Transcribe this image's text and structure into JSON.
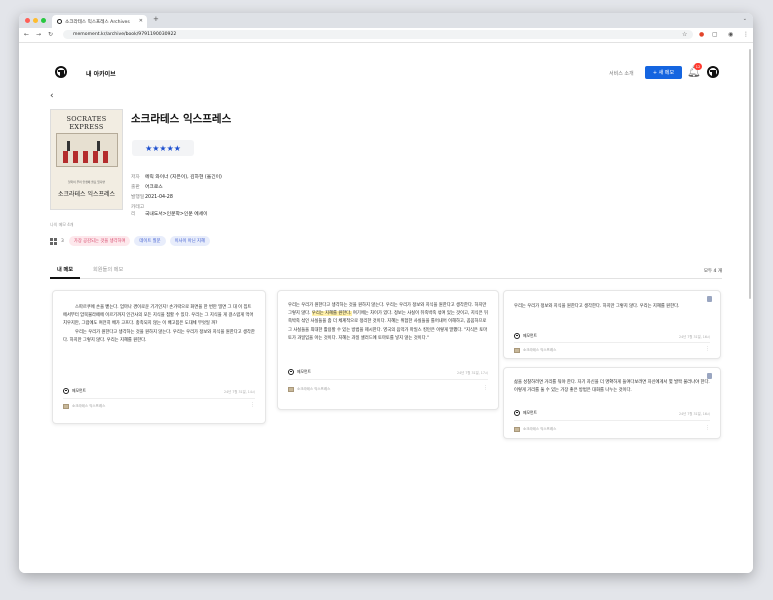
{
  "browser": {
    "tab_title": "소크라테스 익스프레스 Archives",
    "url": "memoment.kr/archive/book/9791190030922"
  },
  "header": {
    "title": "내 아카이브",
    "service_link": "서비스 소개",
    "new_memo_button": "+ 새 메모",
    "notification_count": "12"
  },
  "book": {
    "title": "소크라테스 익스프레스",
    "rating": "★★★★★",
    "cover_title_en": "SOCRATES EXPRESS",
    "cover_subtitle": "철학이 우리 인생에 쓸모 있다면",
    "cover_title_ko": "소크라테스 익스프레스",
    "author_label": "저자",
    "author": "에릭 와이너 (지은이), 김하현 (옮긴이)",
    "publisher_label": "출판",
    "publisher": "어크로스",
    "date_label": "발행일",
    "date": "2021-04-28",
    "category_label": "카테고리",
    "category": "국내도서>인문학>인문 에세이"
  },
  "my_memo_date": "나의 메모 4개",
  "tags": {
    "count": "3",
    "items": [
      {
        "label": "가장 공감되는 것을 생각하며",
        "bg": "#fde8ec",
        "fg": "#d6456a"
      },
      {
        "label": "데이트 질문",
        "bg": "#e8edfb",
        "fg": "#3d5bd0"
      },
      {
        "label": "이사이 아닌 지혜",
        "bg": "#e8edfb",
        "fg": "#3d5bd0"
      }
    ]
  },
  "tabs": {
    "my_memo": "내 메모",
    "others_memo": "회원들의 메모",
    "count": "모두 4 개"
  },
  "cards": [
    {
      "paragraphs": [
        "스파르쿠에 손을 뻗는다. 엄마나 경이로운 기기인지! 손가락으로 화면을 한 번만 밀면 그 대 이 집트에서부터 암묵불라떼에 이르기까지 인간사의 모든 지식을 접할 수 있다. 우리는 그 지식을 게 걸스럽게 먹어치우지만, 그럼에도 여전히 배가 고프다. 충족되지 않는 이 배고픔은 도대체 무엇일 까?",
        "우리는 우리가 원한다고 생각하는 것을 원하지 않는다. 우리는 우리가 정보와 지식을 원한다고 생각한다. 하지만 그렇지 않다. 우리는 지혜를 원한다."
      ],
      "author": "메모먼트",
      "date": "24년 7월 31일, 14시",
      "book": "소크라테스 익스프레스"
    },
    {
      "before": "우리는 우리가 원한다고 생각하는 것을 원하지 않는다. 우리는 우리가 정보와 지식을 원한다고 생각한다. 하지만 그렇지 않다. ",
      "highlight": "우리는 지혜를 원한다.",
      "after": " 여기에는 차이가 있다. 정보는 사실이 뒤죽박죽 섞여 있는 것이고, 지식은 뒤죽박죽 섞인 사실들을 좀 더 체계적으로 정리한 것이다. 지혜는 위험한 사실들을 틀어내어 이해하고, 꼼꼼하므로 그 사실들을 최대한 활용할 수 있는 방법을 제시한다. 영국의 음악가 마일스 킹턴은 이렇게 말했다. \"지식은 토마토가 과일임을 아는 것이다. 지혜는 과일 샐러드에 토마토를 넣지 않는 것이다.\"",
      "author": "메모먼트",
      "date": "24년 7월 31일, 17시",
      "book": "소크라테스 익스프레스"
    },
    {
      "text": "우리는 우리가 정보와 지식을 원한다고 생각한다. 하지만 그렇지 않다. 우리는 지혜를 원한다.",
      "author": "메모먼트",
      "date": "24년 7월 31일, 16시",
      "book": "소크라테스 익스프레스"
    },
    {
      "text": "삶을 성찰하려면 거리를 둬야 한다. 자기 자신을 더 명확하게 들여다보려면 자신에게서 몇 발짝 물러나야 한다. 이렇게 거리를 둘 수 있는 가장 좋은 방법은 대화를 나누는 것이다.",
      "author": "메모먼트",
      "date": "24년 7월 31일, 16시",
      "book": "소크라테스 익스프레스"
    }
  ]
}
